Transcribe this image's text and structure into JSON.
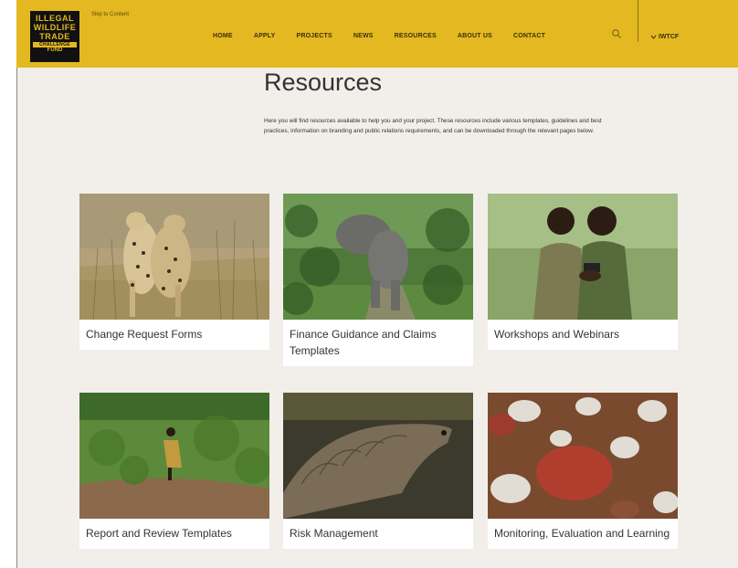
{
  "logo": {
    "lines": [
      "ILLEGAL",
      "WILDLIFE",
      "TRADE"
    ],
    "sub1": "CHALLENGE",
    "sub2": "FUND"
  },
  "header": {
    "skip_link": "Skip to Content",
    "lang_label": "IWTCF",
    "search_icon": "search-icon",
    "chevron_icon": "chevron-down-icon"
  },
  "nav": {
    "items": [
      {
        "label": "HOME"
      },
      {
        "label": "APPLY"
      },
      {
        "label": "PROJECTS"
      },
      {
        "label": "NEWS"
      },
      {
        "label": "RESOURCES"
      },
      {
        "label": "ABOUT US"
      },
      {
        "label": "CONTACT"
      }
    ]
  },
  "page": {
    "title": "Resources",
    "intro": "Here you will find resources available to help you and your project. These resources include various templates, guidelines and best practices, information on branding and public relations requirements, and can be downloaded through the relevant pages below."
  },
  "cards": [
    {
      "label": "Change Request Forms"
    },
    {
      "label": "Finance Guidance and Claims Templates"
    },
    {
      "label": "Workshops and Webinars"
    },
    {
      "label": "Report and Review Templates"
    },
    {
      "label": "Risk Management"
    },
    {
      "label": "Monitoring, Evaluation and Learning"
    }
  ],
  "colors": {
    "header": "#e4b821",
    "background": "#f2efea"
  }
}
